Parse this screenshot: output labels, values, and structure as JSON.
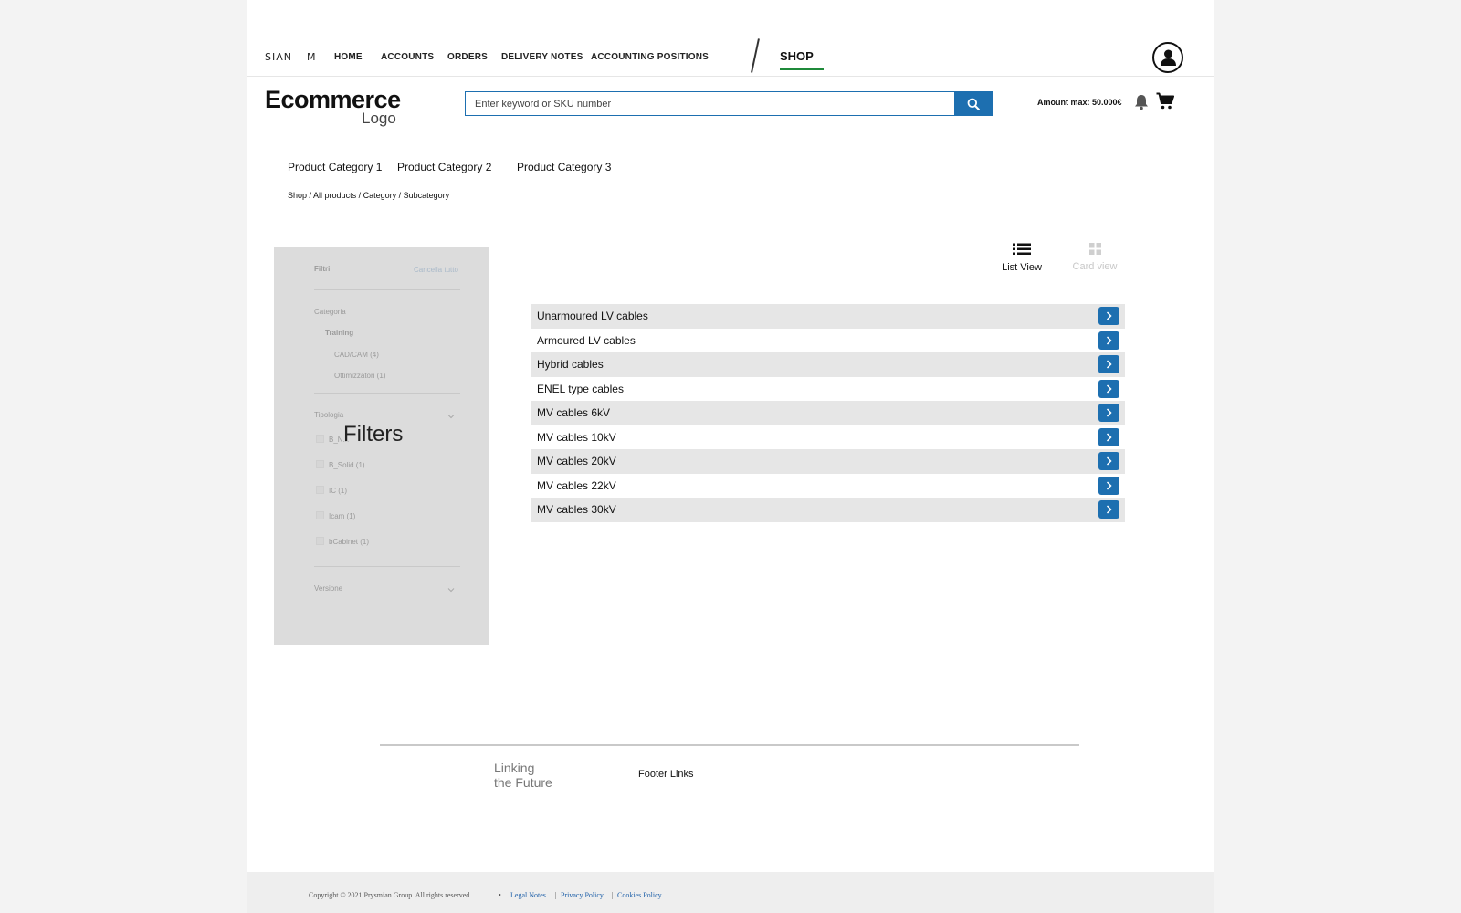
{
  "topnav": {
    "brand_mark": "SIAN",
    "brand_mark2": "M",
    "items": [
      "HOME",
      "ACCOUNTS",
      "ORDERS",
      "DELIVERY NOTES",
      "ACCOUNTING POSITIONS"
    ],
    "shop": "SHOP"
  },
  "header": {
    "logo_main": "Ecommerce",
    "logo_sub": "Logo",
    "search_placeholder": "Enter keyword or SKU number",
    "amount": "Amount max: 50.000€"
  },
  "categories": [
    "Product Category 1",
    "Product Category 2",
    "Product Category 3"
  ],
  "breadcrumb": [
    "Shop",
    "All products",
    "Category",
    "Subcategory"
  ],
  "filters": {
    "title": "Filtri",
    "clear_all": "Cancella tutto",
    "categoria": "Categoria",
    "training": "Training",
    "cadcam": "CAD/CAM (4)",
    "ottimizzatori": "Ottimizzatori (1)",
    "tipologia": "Tipologia",
    "options": [
      "B_N...",
      "B_Solid (1)",
      "IC (1)",
      "Icam (1)",
      "bCabinet (1)"
    ],
    "versione": "Versione",
    "overlay": "Filters"
  },
  "view": {
    "list": "List View",
    "card": "Card view"
  },
  "products": [
    "Unarmoured LV cables",
    "Armoured LV cables",
    "Hybrid cables",
    "ENEL type cables",
    "MV cables 6kV",
    "MV cables 10kV",
    "MV cables 20kV",
    "MV cables 22kV",
    "MV cables 30kV"
  ],
  "footer": {
    "tagline_1": "Linking",
    "tagline_2": "the Future",
    "links": "Footer Links",
    "copyright": "Copyright © 2021 Prysmian Group. All rights reserved",
    "legal_notes": "Legal Notes",
    "privacy": "Privacy Policy",
    "cookies": "Cookies Policy"
  },
  "colors": {
    "accent_blue": "#1d6fb0",
    "shop_green": "#1f8a3a"
  }
}
